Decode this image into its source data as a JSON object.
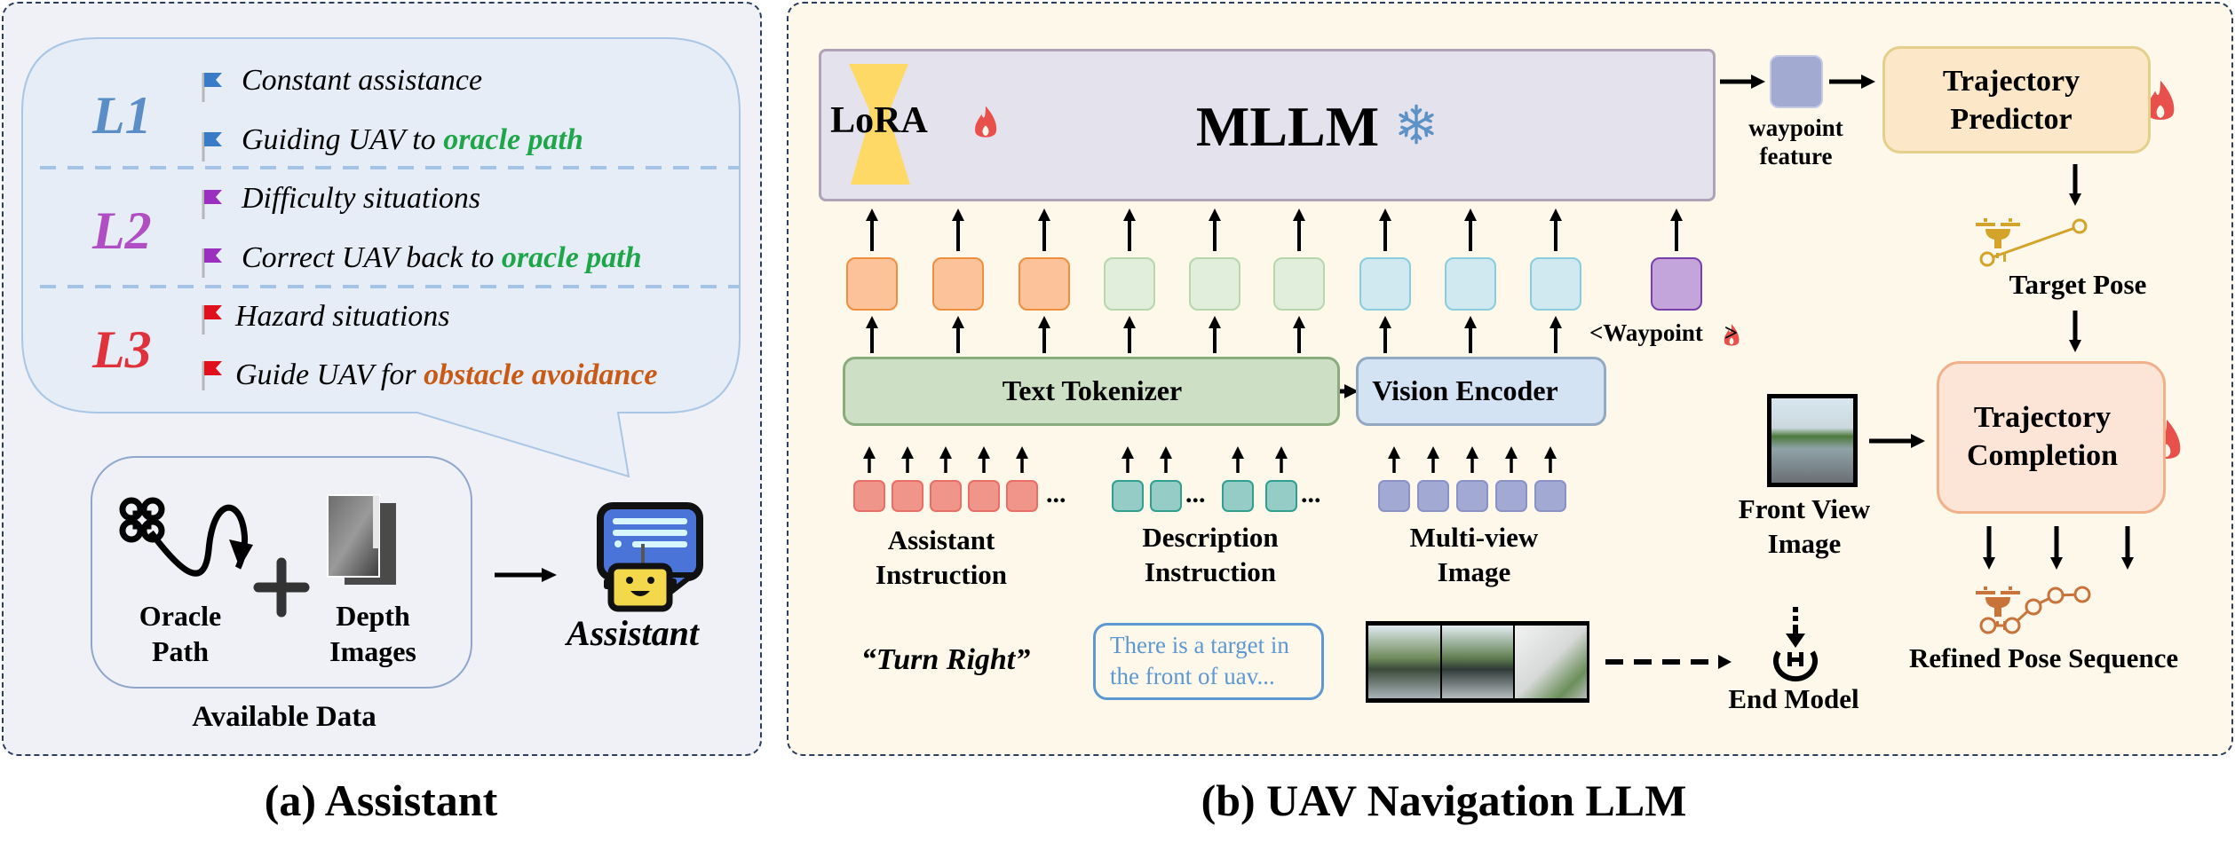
{
  "panel_a": {
    "caption": "(a) Assistant",
    "levels": [
      {
        "label": "L1",
        "color": "#5b8ec7",
        "flag_color": "#3a7bc8",
        "items": [
          {
            "text": "Constant assistance",
            "highlight": "",
            "highlight_color": ""
          },
          {
            "text": "Guiding UAV to ",
            "highlight": "oracle path",
            "highlight_color": "#1fa64a"
          }
        ]
      },
      {
        "label": "L2",
        "color": "#b04fc4",
        "flag_color": "#9b2fc0",
        "items": [
          {
            "text": "Difficulty situations",
            "highlight": "",
            "highlight_color": ""
          },
          {
            "text": "Correct UAV back to ",
            "highlight": "oracle path",
            "highlight_color": "#1fa64a"
          }
        ]
      },
      {
        "label": "L3",
        "color": "#e0323c",
        "flag_color": "#e0101c",
        "items": [
          {
            "text": "Hazard situations",
            "highlight": "",
            "highlight_color": ""
          },
          {
            "text": "Guide UAV for ",
            "highlight": "obstacle avoidance",
            "highlight_color": "#c85a16"
          }
        ]
      }
    ],
    "available_data": {
      "title": "Available Data",
      "oracle_path": "Oracle\nPath",
      "oracle_path_l1": "Oracle",
      "oracle_path_l2": "Path",
      "depth_l1": "Depth",
      "depth_l2": "Images",
      "plus": "+"
    },
    "assistant_label": "Assistant"
  },
  "panel_b": {
    "caption": "(b) UAV Navigation LLM",
    "mllm_label": "MLLM",
    "lora_label": "LoRA",
    "text_tokenizer": "Text Tokenizer",
    "vision_encoder": "Vision Encoder",
    "waypoint_token": "<Waypoint",
    "waypoint_token_close": ">",
    "waypoint_feature_l1": "waypoint",
    "waypoint_feature_l2": "feature",
    "inputs": [
      {
        "l1": "Assistant",
        "l2": "Instruction",
        "example": "“Turn Right”"
      },
      {
        "l1": "Description",
        "l2": "Instruction",
        "example": "There is a target in the front of uav..."
      },
      {
        "l1": "Multi-view",
        "l2": "Image",
        "example": ""
      }
    ],
    "description_example_l1": "There is a target in",
    "description_example_l2": "the front of uav...",
    "ellipsis": "...",
    "end_model": "End Model",
    "trajectory_predictor_l1": "Trajectory",
    "trajectory_predictor_l2": "Predictor",
    "target_pose": "Target Pose",
    "front_view_l1": "Front View",
    "front_view_l2": "Image",
    "trajectory_completion_l1": "Trajectory",
    "trajectory_completion_l2": "Completion",
    "refined_pose": "Refined Pose Sequence"
  },
  "colors": {
    "left_bg": "#eff1f6",
    "right_bg": "#fdf8ea",
    "bubble_bg": "#e6edf6",
    "bubble_border": "#a9c6e6",
    "mllm_bg": "#e4e2ed",
    "mllm_border": "#b0a3b8",
    "lora": "#fed966",
    "flame": "#e8504c",
    "snow": "#5d92c6",
    "text_tok_bg": "#cde0c6",
    "text_tok_border": "#8aab7c",
    "vis_enc_bg": "#d3e3f4",
    "vis_enc_border": "#93a9c2",
    "tok_orange_bg": "#fcc39b",
    "tok_orange_border": "#ef8f3d",
    "tok_green_bg": "#e0eedb",
    "tok_green_border": "#b8d6ad",
    "tok_blue_bg": "#d0e8ef",
    "tok_blue_border": "#8ccbe0",
    "tok_purple_bg": "#c3a5dc",
    "tok_purple_border": "#7a3fa8",
    "in_red_bg": "#f0958a",
    "in_red_border": "#e96e66",
    "in_teal_bg": "#95ccc6",
    "in_teal_border": "#2fa08f",
    "in_blue_bg": "#a2a9d3",
    "in_blue_border": "#8b92c6",
    "wf_bg": "#a2aad2",
    "tp_bg": "#fce8c8",
    "tp_border": "#e4cf8b",
    "tc_bg": "#fce4d7",
    "tc_border": "#f1b089",
    "pose_gold": "#d4a32a",
    "pose_orange": "#c8733a",
    "desc_blue": "#5d98d2"
  }
}
